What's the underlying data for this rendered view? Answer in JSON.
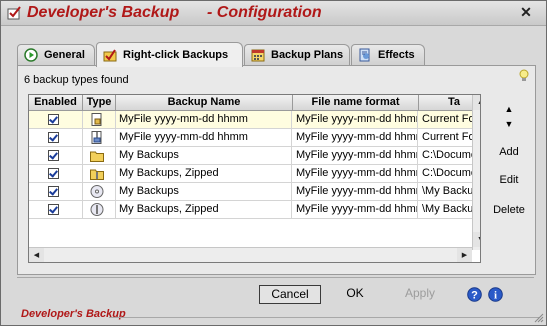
{
  "window": {
    "title": "Developer's Backup",
    "subtitle": "- Configuration",
    "close_icon": "close-icon"
  },
  "tabs": [
    {
      "label": "General",
      "icon": "play-circle-icon",
      "active": false
    },
    {
      "label": "Right-click Backups",
      "icon": "checkbox-folder-icon",
      "active": true
    },
    {
      "label": "Backup Plans",
      "icon": "calendar-icon",
      "active": false
    },
    {
      "label": "Effects",
      "icon": "effects-icon",
      "active": false
    }
  ],
  "panel": {
    "found_label": "6 backup types found",
    "hint_icon": "lightbulb-icon"
  },
  "table": {
    "columns": [
      "Enabled",
      "Type",
      "Backup Name",
      "File name format",
      "Ta"
    ],
    "rows": [
      {
        "enabled": true,
        "type": "document-lock-icon",
        "name": "MyFile yyyy-mm-dd hhmm",
        "format": "MyFile yyyy-mm-dd hhmm",
        "target": "Current Folde",
        "selected": true
      },
      {
        "enabled": true,
        "type": "zip-document-icon",
        "name": "MyFile yyyy-mm-dd hhmm",
        "format": "MyFile yyyy-mm-dd hhmm",
        "target": "Current Folde",
        "selected": false
      },
      {
        "enabled": true,
        "type": "folder-icon",
        "name": "My Backups",
        "format": "MyFile yyyy-mm-dd hhmm",
        "target": "C:\\Documen",
        "selected": false
      },
      {
        "enabled": true,
        "type": "zip-folder-icon",
        "name": "My Backups, Zipped",
        "format": "MyFile yyyy-mm-dd hhmm",
        "target": "C:\\Documen",
        "selected": false
      },
      {
        "enabled": true,
        "type": "cd-icon",
        "name": "My Backups",
        "format": "MyFile yyyy-mm-dd hhmm",
        "target": "\\My Backups",
        "selected": false
      },
      {
        "enabled": true,
        "type": "zip-cd-icon",
        "name": "My Backups, Zipped",
        "format": "MyFile yyyy-mm-dd hhmm",
        "target": "\\My Backups",
        "selected": false
      }
    ]
  },
  "side_buttons": {
    "up_icon": "triangle-up-icon",
    "down_icon": "triangle-down-icon",
    "add": "Add",
    "edit": "Edit",
    "delete": "Delete"
  },
  "footer": {
    "cancel": "Cancel",
    "ok": "OK",
    "apply": "Apply",
    "help_icon": "help-icon",
    "info_icon": "info-icon",
    "brand": "Developer's Backup"
  }
}
